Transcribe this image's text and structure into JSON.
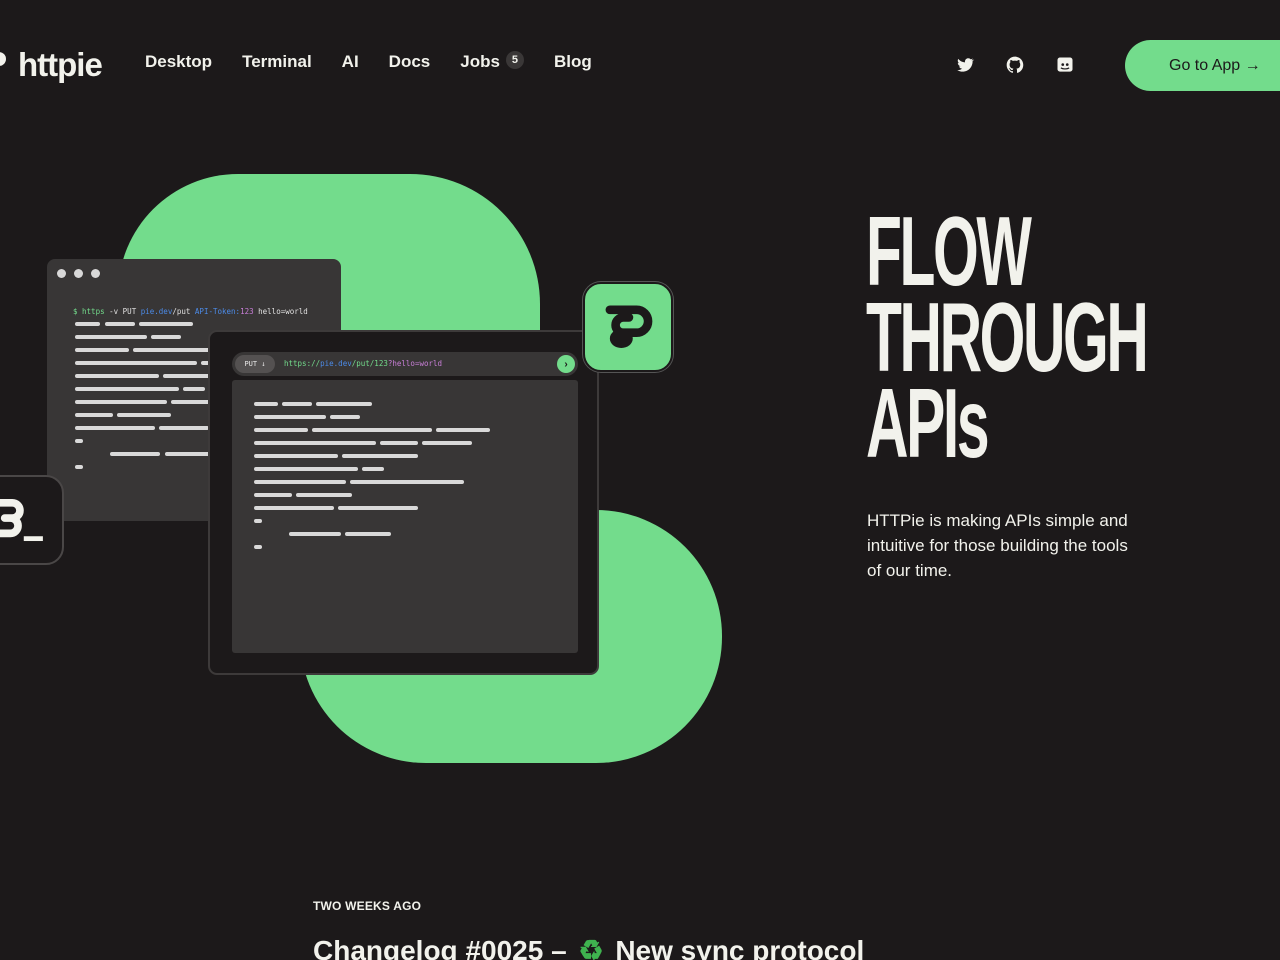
{
  "nav": {
    "logo_text": "httpie",
    "links": [
      {
        "label": "Desktop"
      },
      {
        "label": "Terminal"
      },
      {
        "label": "AI"
      },
      {
        "label": "Docs"
      },
      {
        "label": "Jobs",
        "badge": "5"
      },
      {
        "label": "Blog"
      }
    ],
    "social_icons": [
      "twitter-icon",
      "github-icon",
      "discord-icon"
    ],
    "cta_label": "Go to App →"
  },
  "hero": {
    "headline_lines": [
      "FLOW",
      "THROUGH",
      "APIs"
    ],
    "tagline": "HTTPie is making APIs simple and intuitive for those building the tools of our time.",
    "terminal_command": {
      "prompt": "$ https",
      "flags": " -v PUT ",
      "host": "pie.dev",
      "path": "/put ",
      "header": "API-Token:",
      "header_value": "123",
      "body": " hello=world"
    },
    "app_request": {
      "method": "PUT ↓",
      "scheme": "https://",
      "host": "pie.dev",
      "path": "/put/123",
      "query": "?hello=world",
      "send_icon": "›"
    }
  },
  "changelog": {
    "kicker": "TWO WEEKS AGO",
    "title_prefix": "Changelog #0025 –",
    "title_icon": "♻",
    "title_suffix": "New sync protocol"
  },
  "colors": {
    "background": "#1c191a",
    "accent_green": "#73dc8c",
    "text": "#f2f2ec",
    "panel": "#383636"
  }
}
